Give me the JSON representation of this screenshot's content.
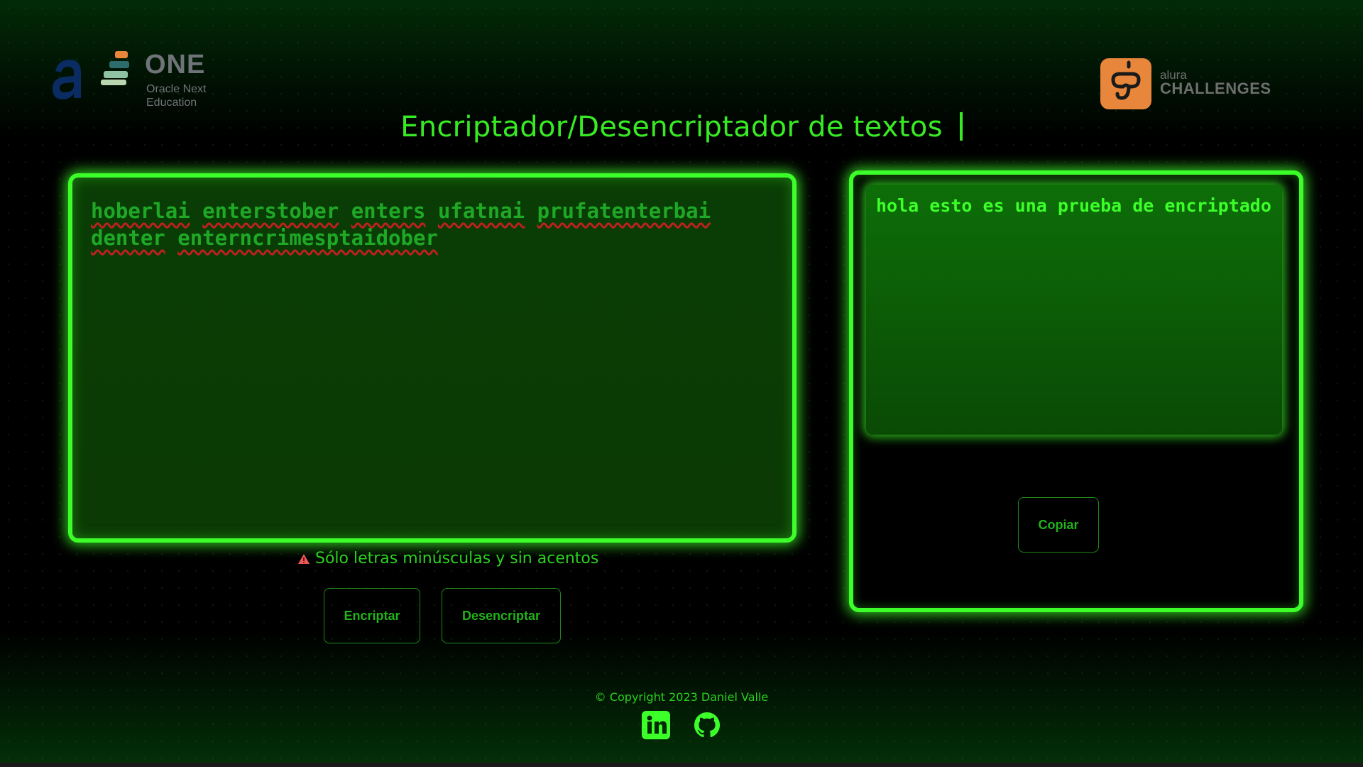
{
  "header": {
    "alura_logo_icon": "alura-a-logo-icon",
    "one_logo": {
      "name": "ONE",
      "subtitle_line1": "Oracle Next",
      "subtitle_line2": "Education"
    },
    "challenges_logo": {
      "small": "alura",
      "big": "CHALLENGES"
    }
  },
  "title": "Encriptador/Desencriptador de textos",
  "input": {
    "words": [
      "hoberlai",
      "enterstober",
      "enters",
      "ufatnai",
      "prufatenterbai",
      "denter",
      "enterncrimesptaidober"
    ]
  },
  "output": {
    "text": "hola esto es una prueba de encriptado"
  },
  "buttons": {
    "copy": "Copiar",
    "encrypt": "Encriptar",
    "decrypt": "Desencriptar"
  },
  "warning": "Sólo letras minúsculas y sin acentos",
  "footer": {
    "copyright": "© Copyright 2023 Daniel Valle",
    "social": [
      "linkedin-icon",
      "github-icon"
    ]
  },
  "colors": {
    "accent": "#3cff2a",
    "background": "#000000",
    "challenges_orange": "#e8873b",
    "alura_blue": "#0a2c63"
  }
}
